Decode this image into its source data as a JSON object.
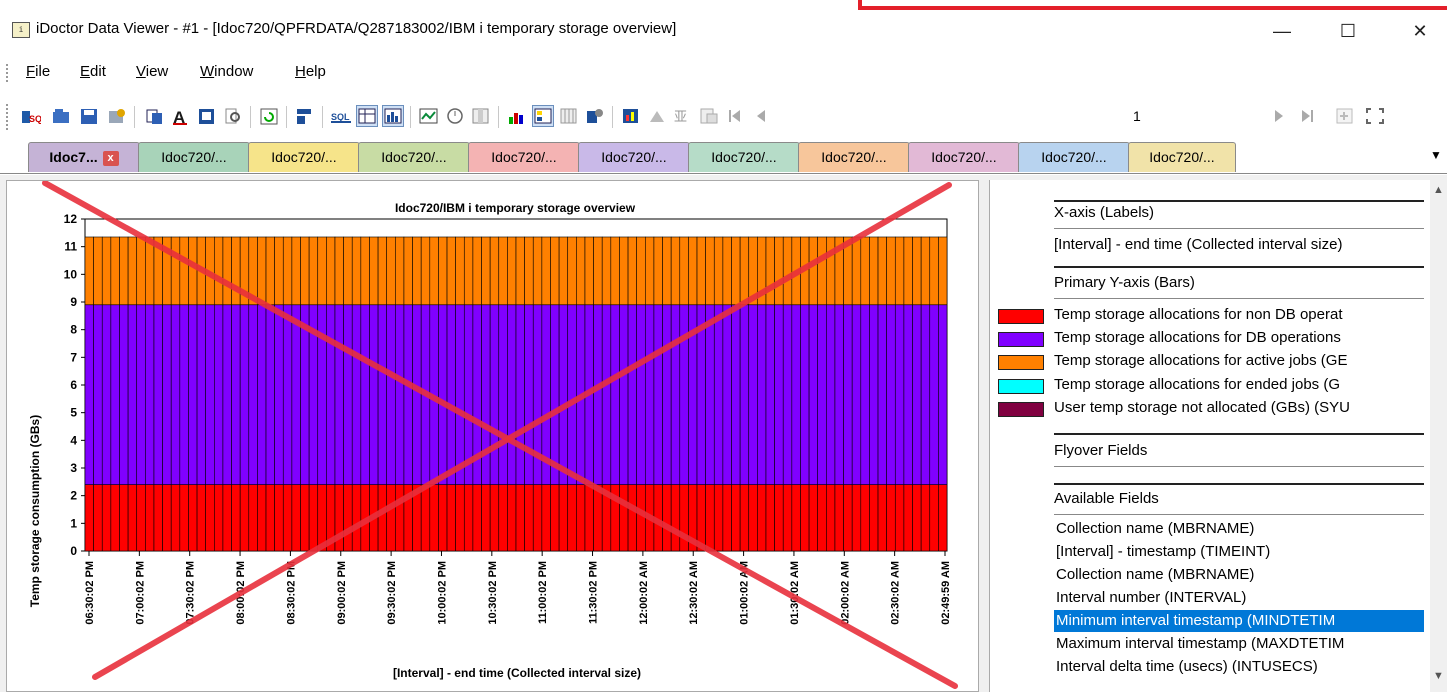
{
  "window": {
    "title": "iDoctor Data Viewer - #1 - [Idoc720/QPFRDATA/Q287183002/IBM i temporary storage overview]",
    "minimize_glyph": "—",
    "maximize_glyph": "☐",
    "close_glyph": "✕",
    "app_icon": "idoctor-app-icon"
  },
  "menu": {
    "items": [
      {
        "label": "File",
        "mnemonic": "F",
        "rest": "ile"
      },
      {
        "label": "Edit",
        "mnemonic": "E",
        "rest": "dit"
      },
      {
        "label": "View",
        "mnemonic": "V",
        "rest": "iew"
      },
      {
        "label": "Window",
        "mnemonic": "W",
        "rest": "indow"
      },
      {
        "label": "Help",
        "mnemonic": "H",
        "rest": "elp"
      }
    ]
  },
  "toolbar": {
    "page_number": "1",
    "icons": [
      "sql-wizard-icon",
      "open-icon",
      "save-icon",
      "properties-icon",
      "copy-icon",
      "font-icon",
      "print-icon",
      "find-icon",
      "refresh-icon",
      "layout-icon",
      "sql-icon",
      "table-view-icon",
      "graph-view-icon",
      "line-graph-icon",
      "clock-icon",
      "panel-icon",
      "bar-colors-icon",
      "legend-icon",
      "columns-icon",
      "graph-props-icon",
      "record-icon",
      "stamp-icon",
      "zoom-icon",
      "export-icon",
      "first-page-icon",
      "prev-page-icon",
      "next-page-icon",
      "last-page-icon",
      "add-icon",
      "fullscreen-icon"
    ]
  },
  "tabs": [
    {
      "label": "Idoc7...",
      "color": "#c5b3d6",
      "active": true,
      "close": "x"
    },
    {
      "label": "Idoc720/...",
      "color": "#a8d3b9"
    },
    {
      "label": "Idoc720/...",
      "color": "#f6e48a"
    },
    {
      "label": "Idoc720/...",
      "color": "#c8dca4"
    },
    {
      "label": "Idoc720/...",
      "color": "#f4b3b3"
    },
    {
      "label": "Idoc720/...",
      "color": "#c9b9e8"
    },
    {
      "label": "Idoc720/...",
      "color": "#b6dcc8"
    },
    {
      "label": "Idoc720/...",
      "color": "#f7c69b"
    },
    {
      "label": "Idoc720/...",
      "color": "#e2b9d6"
    },
    {
      "label": "Idoc720/...",
      "color": "#b8d3ef"
    },
    {
      "label": "Idoc720/...",
      "color": "#f1e3a9"
    }
  ],
  "chart_data": {
    "type": "bar",
    "stacked": true,
    "title": "Idoc720/IBM i temporary storage overview",
    "xlabel": "[Interval] - end time (Collected interval size)",
    "ylabel": "Temp storage consumption (GBs)",
    "ylim": [
      0,
      12
    ],
    "yticks": [
      0,
      1,
      2,
      3,
      4,
      5,
      6,
      7,
      8,
      9,
      10,
      11,
      12
    ],
    "num_bars": 100,
    "x_tick_labels": [
      "06:30:02 PM",
      "07:00:02 PM",
      "07:30:02 PM",
      "08:00:02 PM",
      "08:30:02 PM",
      "09:00:02 PM",
      "09:30:02 PM",
      "10:00:02 PM",
      "10:30:02 PM",
      "11:00:02 PM",
      "11:30:02 PM",
      "12:00:02 AM",
      "12:30:02 AM",
      "01:00:02 AM",
      "01:30:02 AM",
      "02:00:02 AM",
      "02:30:02 AM",
      "02:49:59 AM"
    ],
    "series": [
      {
        "name": "Temp storage allocations for non DB operat",
        "color": "#ff0000",
        "value": 2.4
      },
      {
        "name": "Temp storage allocations for DB operations",
        "color": "#8000ff",
        "value": 6.5
      },
      {
        "name": "Temp storage allocations for active jobs (GE",
        "color": "#ff8000",
        "value": 2.45
      },
      {
        "name": "Temp storage allocations for ended jobs (G",
        "color": "#00ffff",
        "value": 0
      },
      {
        "name": "User temp storage not allocated (GBs) (SYU",
        "color": "#800040",
        "value": 0
      }
    ],
    "grid": false,
    "legend": "right",
    "overlay": "red-x-cross"
  },
  "panel": {
    "xaxis_header": "X-axis (Labels)",
    "xaxis_value": "[Interval] - end time (Collected interval size)",
    "yaxis_header": "Primary Y-axis (Bars)",
    "flyover_header": "Flyover Fields",
    "available_header": "Available Fields",
    "available_fields": [
      "Collection name (MBRNAME)",
      "[Interval] - timestamp (TIMEINT)",
      "Collection name (MBRNAME)",
      "Interval number (INTERVAL)",
      "Minimum interval timestamp (MINDTETIM",
      "Maximum interval timestamp (MAXDTETIM",
      "Interval delta time (usecs) (INTUSECS)"
    ],
    "selected_index": 4
  }
}
